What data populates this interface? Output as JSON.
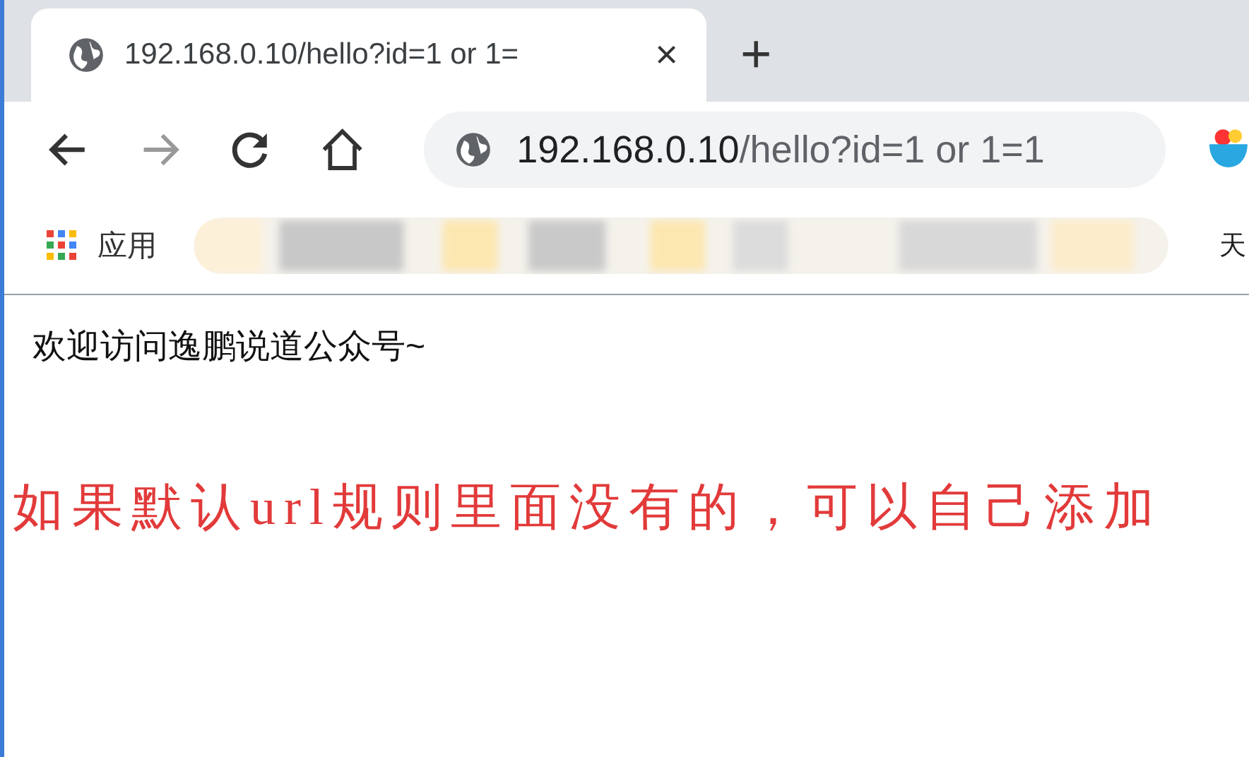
{
  "tabs": [
    {
      "title": "192.168.0.10/hello?id=1 or 1=",
      "selected": true,
      "close": "×"
    }
  ],
  "new_tab": "+",
  "address_bar": {
    "host": "192.168.0.10",
    "path": "/hello?id=1 or 1=1"
  },
  "bookmarks_bar": {
    "apps_label": "应用",
    "cut_label": "天"
  },
  "page": {
    "greeting": "欢迎访问逸鹏说道公众号~",
    "annotation": "如果默认url规则里面没有的，可以自己添加"
  }
}
